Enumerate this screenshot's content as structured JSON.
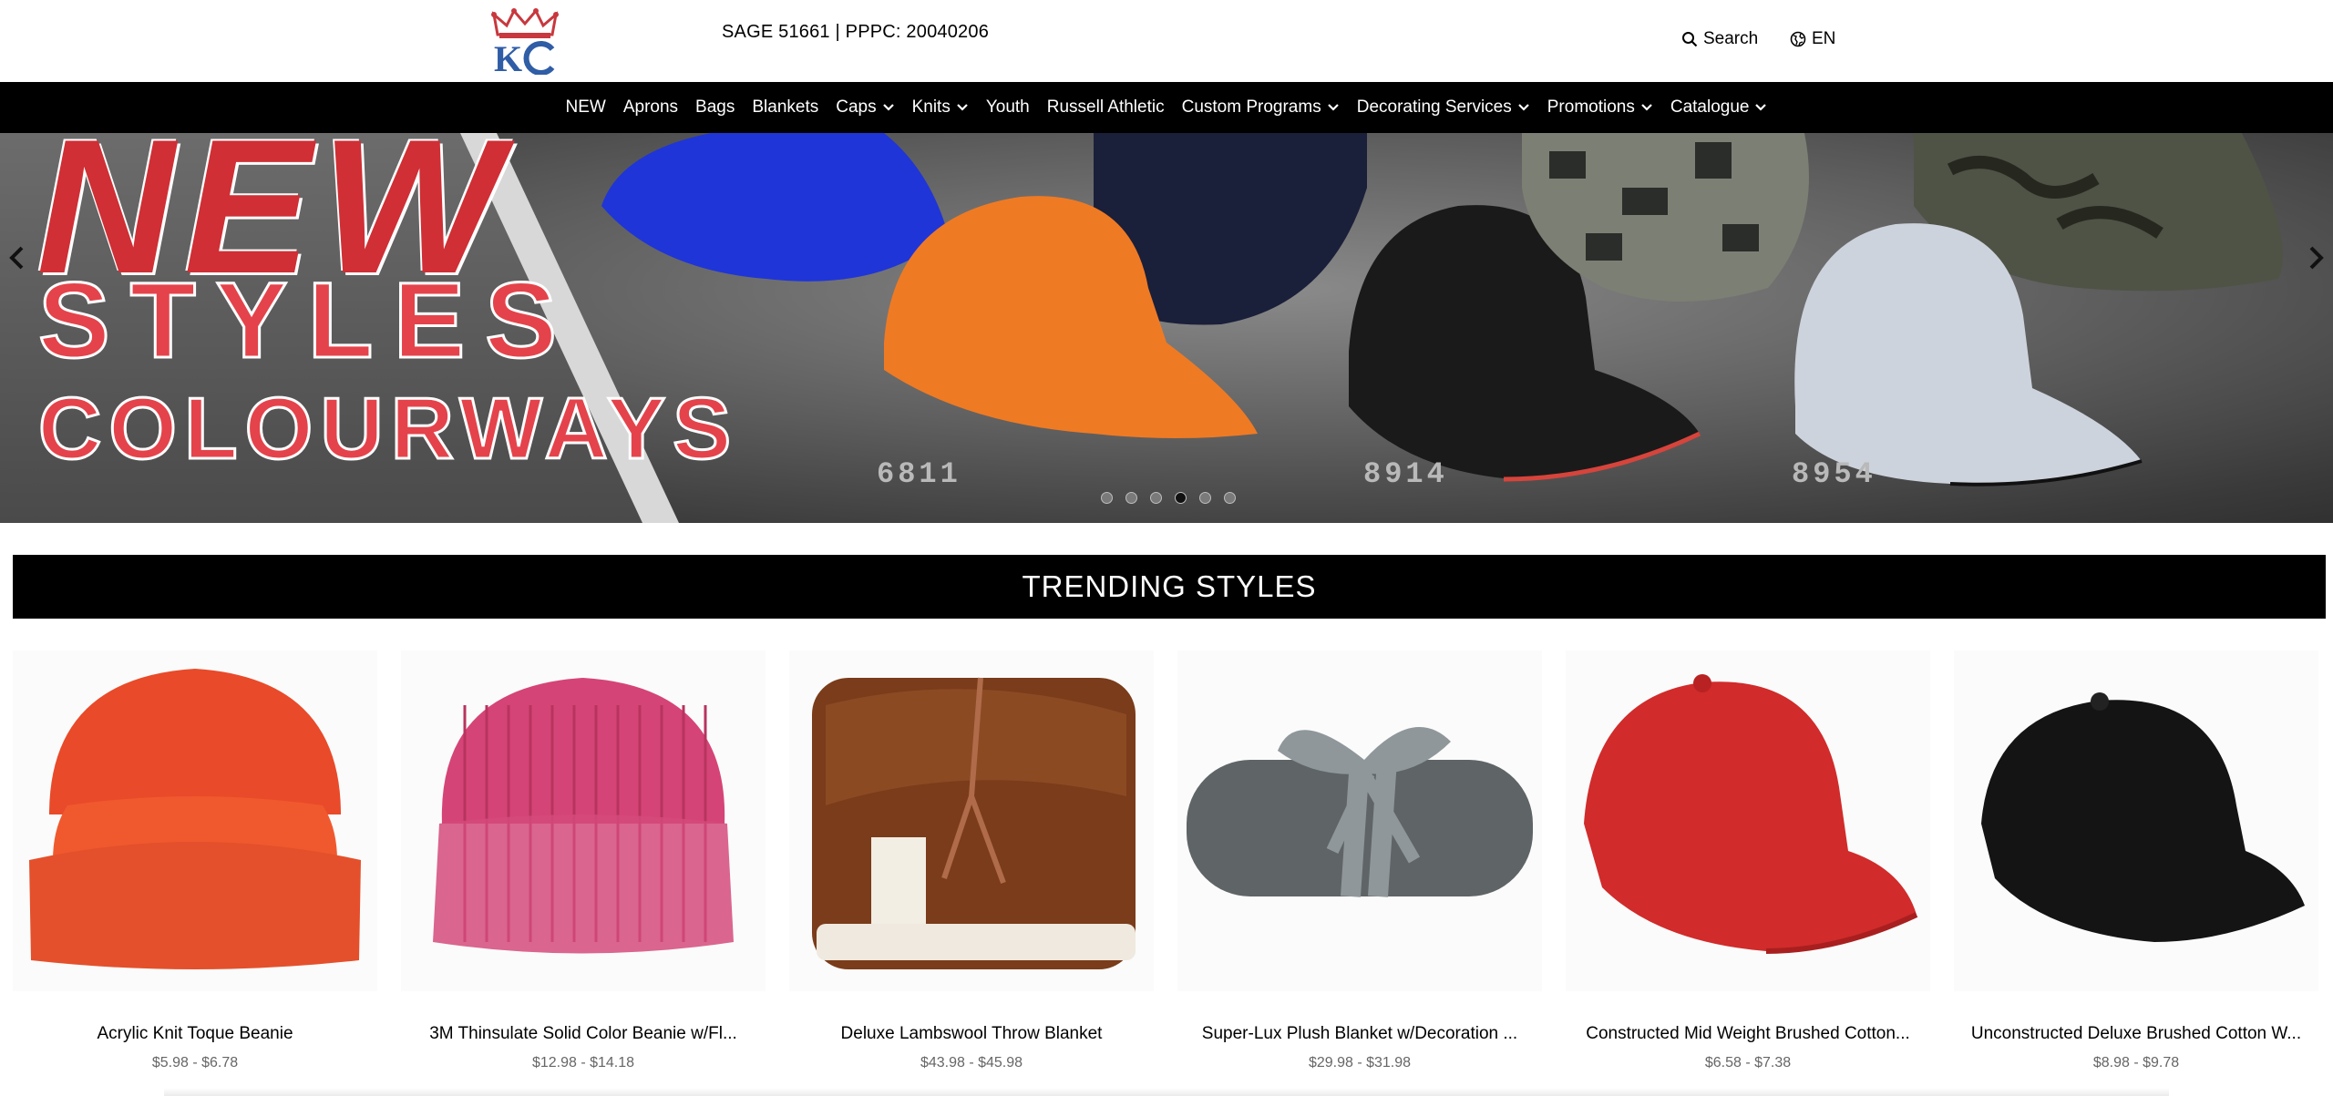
{
  "header": {
    "sage_text": "SAGE 51661 | PPPC: 20040206",
    "search_label": "Search",
    "language_label": "EN",
    "logo_text": "KC"
  },
  "nav": {
    "items": [
      {
        "label": "NEW",
        "has_dropdown": false
      },
      {
        "label": "Aprons",
        "has_dropdown": false
      },
      {
        "label": "Bags",
        "has_dropdown": false
      },
      {
        "label": "Blankets",
        "has_dropdown": false
      },
      {
        "label": "Caps",
        "has_dropdown": true
      },
      {
        "label": "Knits",
        "has_dropdown": true
      },
      {
        "label": "Youth",
        "has_dropdown": false
      },
      {
        "label": "Russell Athletic",
        "has_dropdown": false
      },
      {
        "label": "Custom Programs",
        "has_dropdown": true
      },
      {
        "label": "Decorating Services",
        "has_dropdown": true
      },
      {
        "label": "Promotions",
        "has_dropdown": true
      },
      {
        "label": "Catalogue",
        "has_dropdown": true
      }
    ]
  },
  "hero": {
    "line1": "NEW",
    "line2": "STYLES",
    "line3": "COLOURWAYS",
    "codes": [
      "6811",
      "8914",
      "8954"
    ],
    "slide_count": 6,
    "active_slide": 4
  },
  "trending": {
    "title": "TRENDING STYLES",
    "products": [
      {
        "name": "Acrylic Knit Toque Beanie",
        "price": "$5.98 - $6.78",
        "icon": "orange-beanie"
      },
      {
        "name": "3M Thinsulate Solid Color Beanie w/Fl...",
        "price": "$12.98 - $14.18",
        "icon": "pink-beanie"
      },
      {
        "name": "Deluxe Lambswool Throw Blanket",
        "price": "$43.98 - $45.98",
        "icon": "brown-blanket"
      },
      {
        "name": "Super-Lux Plush Blanket w/Decoration ...",
        "price": "$29.98 - $31.98",
        "icon": "grey-rolled-blanket"
      },
      {
        "name": "Constructed Mid Weight Brushed Cotton...",
        "price": "$6.58 - $7.38",
        "icon": "red-cap"
      },
      {
        "name": "Unconstructed Deluxe Brushed Cotton W...",
        "price": "$8.98 - $9.78",
        "icon": "black-cap"
      }
    ]
  },
  "colors": {
    "nav_bg": "#000000",
    "accent_red": "#e4434b",
    "text": "#000000",
    "price_grey": "#666666"
  }
}
